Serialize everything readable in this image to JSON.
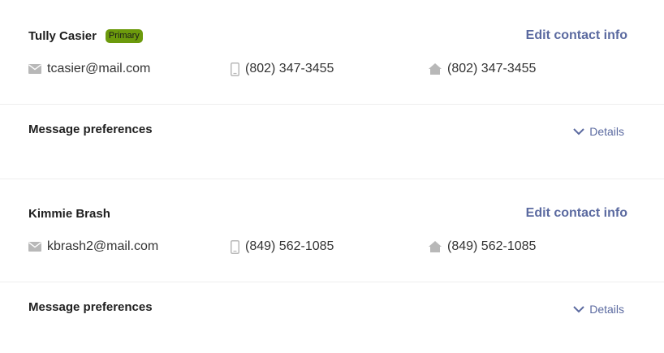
{
  "contacts": [
    {
      "name": "Tully Casier",
      "badge": "Primary",
      "edit_label": "Edit contact info",
      "email": "tcasier@mail.com",
      "mobile": "(802) 347-3455",
      "home": "(802) 347-3455",
      "prefs_title": "Message preferences",
      "details_label": "Details"
    },
    {
      "name": "Kimmie Brash",
      "badge": "",
      "edit_label": "Edit contact info",
      "email": "kbrash2@mail.com",
      "mobile": "(849) 562-1085",
      "home": "(849) 562-1085",
      "prefs_title": "Message preferences",
      "details_label": "Details"
    }
  ],
  "icons": {
    "email": "envelope-icon",
    "mobile": "mobile-phone-icon",
    "home": "home-icon",
    "details": "chevron-down-icon"
  },
  "colors": {
    "accent": "#5b6aa0",
    "badge": "#6c9a0c",
    "icon_gray": "#b8b8b8",
    "divider": "#eeeeee"
  }
}
